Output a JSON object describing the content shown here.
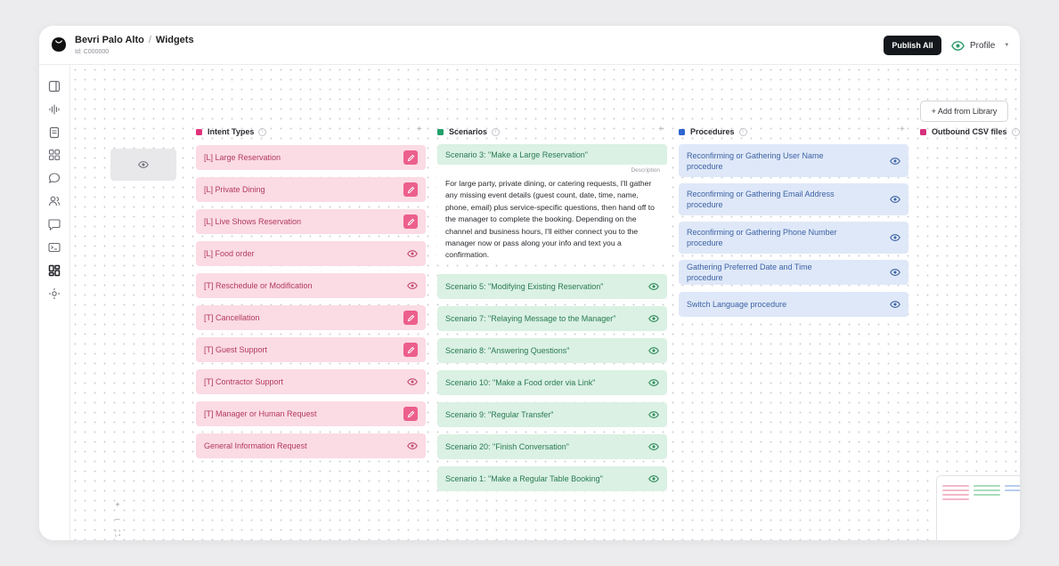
{
  "header": {
    "org_name": "Bevri Palo Alto",
    "separator": "/",
    "page_name": "Widgets",
    "org_id": "Id: C000000",
    "publish_label": "Publish All",
    "profile_label": "Profile"
  },
  "rail": {
    "icons": [
      "panel-icon",
      "waveform-icon",
      "document-icon",
      "grid-icon",
      "chat-bubble-icon",
      "users-icon",
      "message-icon",
      "terminal-icon",
      "widgets-icon",
      "settings-icon"
    ],
    "active": "widgets-icon"
  },
  "canvas": {
    "add_library_label": "+ Add from Library",
    "zoom_controls": [
      "+",
      "–",
      "⛶",
      "="
    ]
  },
  "columns": {
    "intent": {
      "title": "Intent Types",
      "color": "#e0337a"
    },
    "scenarios": {
      "title": "Scenarios",
      "color": "#22a06b"
    },
    "procedures": {
      "title": "Procedures",
      "color": "#2f66d0"
    },
    "outbound": {
      "title": "Outbound CSV files",
      "color": "#d6307d"
    }
  },
  "intent_types": [
    {
      "label": "[L] Large Reservation",
      "action": "edit"
    },
    {
      "label": "[L] Private Dining",
      "action": "edit"
    },
    {
      "label": "[L] Live Shows Reservation",
      "action": "edit"
    },
    {
      "label": "[L] Food order",
      "action": "view"
    },
    {
      "label": "[T] Reschedule or Modification",
      "action": "view"
    },
    {
      "label": "[T] Cancellation",
      "action": "edit"
    },
    {
      "label": "[T] Guest Support",
      "action": "edit"
    },
    {
      "label": "[T] Contractor Support",
      "action": "view"
    },
    {
      "label": "[T] Manager or Human Request",
      "action": "edit"
    },
    {
      "label": "General Information Request",
      "action": "view"
    }
  ],
  "scenario_expanded": {
    "label": "Scenario 3: \"Make a Large Reservation\"",
    "description_label": "Description",
    "description": "For large party, private dining, or catering requests, I'll gather any missing event details (guest count, date, time, name, phone, email) plus service-specific questions, then hand off to the manager to complete the booking. Depending on the channel and business hours, I'll either connect you to the manager now or pass along your info and text you a confirmation."
  },
  "scenarios": [
    {
      "label": "Scenario 5: \"Modifying Existing Reservation\""
    },
    {
      "label": "Scenario 7: \"Relaying Message to the Manager\""
    },
    {
      "label": "Scenario 8: \"Answering Questions\""
    },
    {
      "label": "Scenario 10: \"Make a Food order via Link\""
    },
    {
      "label": "Scenario 9: \"Regular Transfer\""
    },
    {
      "label": "Scenario 20: \"Finish Conversation\""
    },
    {
      "label": "Scenario 1: \"Make a Regular Table Booking\""
    }
  ],
  "procedures": [
    {
      "label": "Reconfirming or Gathering User Name procedure"
    },
    {
      "label": "Reconfirming or Gathering Email Address procedure"
    },
    {
      "label": "Reconfirming or Gathering Phone Number procedure"
    },
    {
      "label": "Gathering Preferred Date and Time procedure"
    },
    {
      "label": "Switch Language procedure"
    }
  ]
}
